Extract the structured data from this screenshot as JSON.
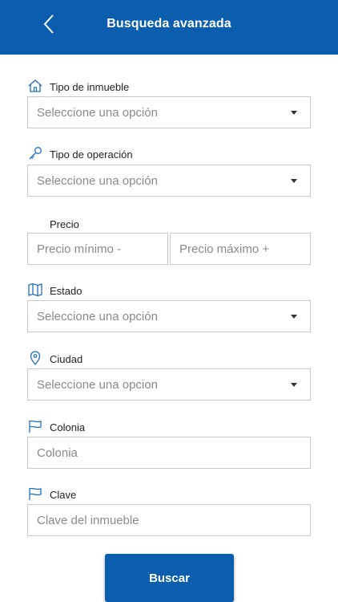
{
  "header": {
    "title": "Busqueda avanzada",
    "back_icon": "chevron-left-icon"
  },
  "form": {
    "tipo_inmueble": {
      "label": "Tipo de inmueble",
      "icon": "house-icon",
      "value": "Seleccione una opción"
    },
    "tipo_operacion": {
      "label": "Tipo de operación",
      "icon": "key-icon",
      "value": "Seleccione una opción"
    },
    "precio": {
      "label": "Precio",
      "min_placeholder": "Precio mínimo -",
      "max_placeholder": "Precio máximo +"
    },
    "estado": {
      "label": "Estado",
      "icon": "map-icon",
      "value": "Seleccione una opción"
    },
    "ciudad": {
      "label": "Ciudad",
      "icon": "location-pin-icon",
      "value": "Seleccione una opcion"
    },
    "colonia": {
      "label": "Colonia",
      "icon": "flag-icon",
      "placeholder": "Colonia"
    },
    "clave": {
      "label": "Clave",
      "icon": "flag-icon",
      "placeholder": "Clave del inmueble"
    }
  },
  "buscar_button": {
    "label": "Buscar"
  },
  "colors": {
    "primary": "#0b5ead",
    "icon": "#1f6fc1",
    "border": "#c9c9c9",
    "placeholder": "#8a8a8a"
  }
}
